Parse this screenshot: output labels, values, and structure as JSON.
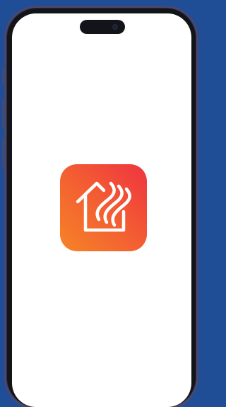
{
  "device": {
    "background_color": "#1f4e96",
    "frame_color": "#12141a",
    "frame_edge_color": "#4a4672",
    "screen_color": "#ffffff"
  },
  "splash": {
    "app_icon": {
      "icon": "house-flame-icon",
      "gradient_start": "#f68427",
      "gradient_end": "#ee3340",
      "glyph_color": "#ffffff"
    }
  }
}
